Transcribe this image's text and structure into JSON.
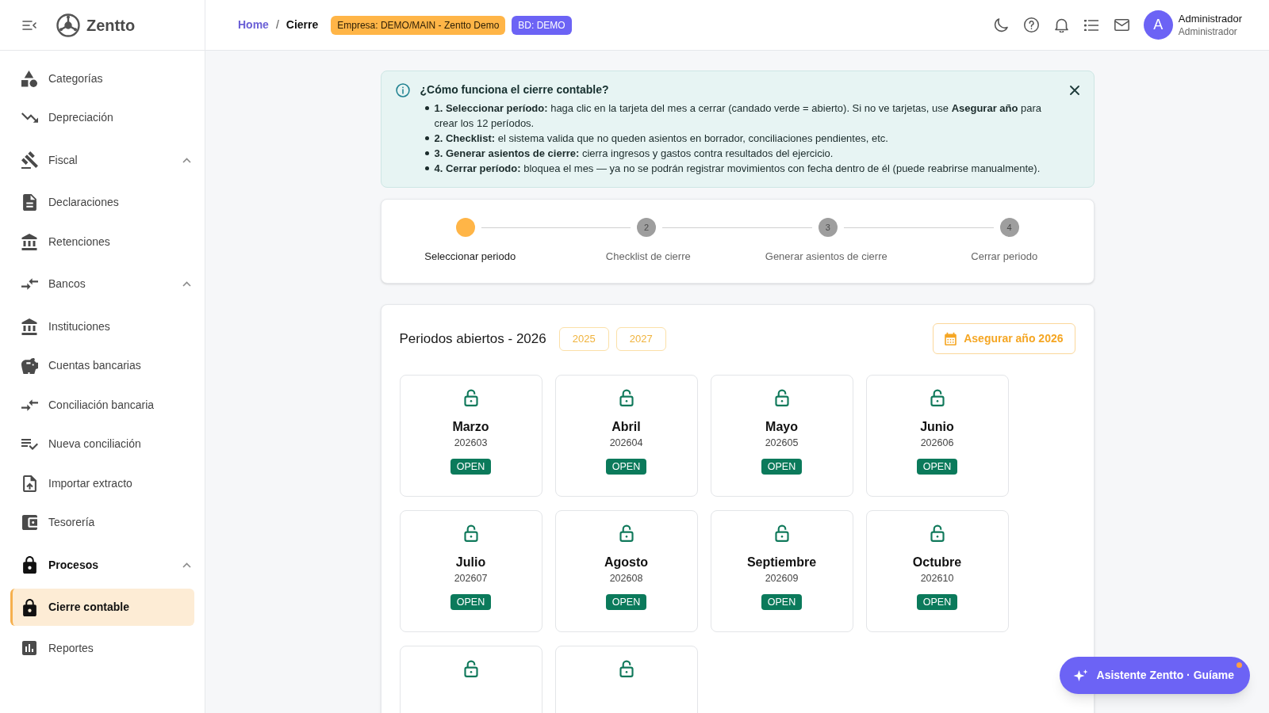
{
  "sidebar": {
    "brand": "Zentto",
    "items": [
      {
        "label": "Categorías",
        "selected": false
      },
      {
        "label": "Depreciación",
        "selected": false
      },
      {
        "label": "Fiscal",
        "selected": false,
        "expanded": true,
        "children": [
          {
            "label": "Declaraciones",
            "selected": false
          },
          {
            "label": "Retenciones",
            "selected": false
          }
        ]
      },
      {
        "label": "Bancos",
        "selected": false,
        "expanded": true,
        "children": [
          {
            "label": "Instituciones",
            "selected": false
          },
          {
            "label": "Cuentas bancarias",
            "selected": false
          },
          {
            "label": "Conciliación bancaria",
            "selected": false
          },
          {
            "label": "Nueva conciliación",
            "selected": false
          },
          {
            "label": "Importar extracto",
            "selected": false
          },
          {
            "label": "Tesorería",
            "selected": false
          }
        ]
      },
      {
        "label": "Procesos",
        "selected": false,
        "expanded": true,
        "children": [
          {
            "label": "Cierre contable",
            "selected": true
          },
          {
            "label": "Reportes",
            "selected": false
          }
        ]
      }
    ]
  },
  "header": {
    "breadcrumb": {
      "separator": "/",
      "items": [
        {
          "label": "Home",
          "kind": "link"
        },
        {
          "label": "Cierre",
          "kind": "current"
        }
      ]
    },
    "badges": [
      {
        "label": "Empresa: DEMO/MAIN - Zentto Demo",
        "color": "#ffb547"
      },
      {
        "label": "BD: DEMO",
        "color": "#6c63f5"
      }
    ],
    "user": {
      "initial": "A",
      "name": "Administrador",
      "role": "Administrador"
    }
  },
  "info": {
    "title": "¿Cómo funciona el cierre contable?",
    "items": [
      "**1. Seleccionar período:** haga clic en la tarjeta del mes a cerrar (candado verde = abierto). Si no ve tarjetas, use **Asegurar año** para crear los 12 períodos.",
      "**2. Checklist:** el sistema valida que no queden asientos en borrador, conciliaciones pendientes, etc.",
      "**3. Generar asientos de cierre:** cierra ingresos y gastos contra resultados del ejercicio.",
      "**4. Cerrar período:** bloquea el mes — ya no se podrán registrar movimientos con fecha dentro de él (puede reabrirse manualmente)."
    ]
  },
  "stepper": {
    "steps": [
      {
        "label": "Seleccionar periodo",
        "selected": true
      },
      {
        "number": "2",
        "label": "Checklist de cierre",
        "selected": false
      },
      {
        "number": "3",
        "label": "Generar asientos de cierre",
        "selected": false
      },
      {
        "number": "4",
        "label": "Cerrar periodo",
        "selected": false
      }
    ]
  },
  "periods": {
    "title": "Periodos abiertos - 2026",
    "years": [
      "2025",
      "2027"
    ],
    "ensure_button": "Asegurar año 2026",
    "cards": [
      {
        "name": "Marzo",
        "code": "202603",
        "status": "OPEN",
        "locked": false
      },
      {
        "name": "Abril",
        "code": "202604",
        "status": "OPEN",
        "locked": false
      },
      {
        "name": "Mayo",
        "code": "202605",
        "status": "OPEN",
        "locked": false
      },
      {
        "name": "Junio",
        "code": "202606",
        "status": "OPEN",
        "locked": false
      },
      {
        "name": "Julio",
        "code": "202607",
        "status": "OPEN",
        "locked": false
      },
      {
        "name": "Agosto",
        "code": "202608",
        "status": "OPEN",
        "locked": false
      },
      {
        "name": "Septiembre",
        "code": "202609",
        "status": "OPEN",
        "locked": false
      },
      {
        "name": "Octubre",
        "code": "202610",
        "status": "OPEN",
        "locked": false
      },
      {
        "locked": false
      },
      {
        "locked": false
      }
    ]
  },
  "assistant": {
    "label": "Asistente Zentto · Guíame",
    "notification": true
  }
}
